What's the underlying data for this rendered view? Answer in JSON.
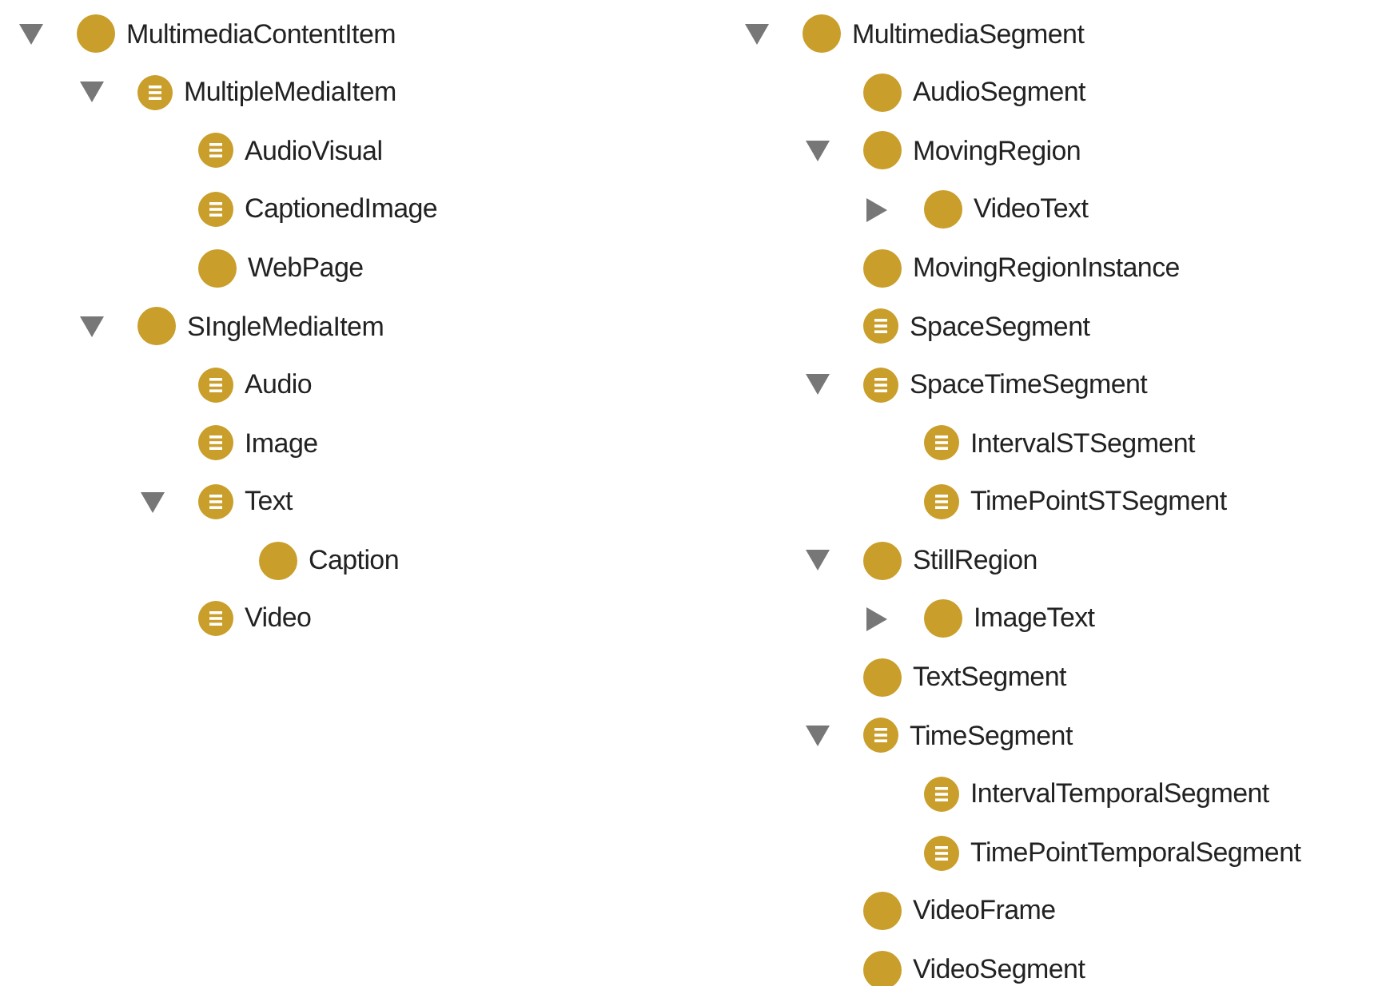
{
  "trees": [
    {
      "label": "MultimediaContentItem",
      "kind": "primitive",
      "expanded": true,
      "children": [
        {
          "label": "MultipleMediaItem",
          "kind": "defined",
          "expanded": true,
          "children": [
            {
              "label": "AudioVisual",
              "kind": "defined"
            },
            {
              "label": "CaptionedImage",
              "kind": "defined"
            },
            {
              "label": "WebPage",
              "kind": "primitive"
            }
          ]
        },
        {
          "label": "SIngleMediaItem",
          "kind": "primitive",
          "expanded": true,
          "children": [
            {
              "label": "Audio",
              "kind": "defined"
            },
            {
              "label": "Image",
              "kind": "defined"
            },
            {
              "label": "Text",
              "kind": "defined",
              "expanded": true,
              "children": [
                {
                  "label": "Caption",
                  "kind": "primitive"
                }
              ]
            },
            {
              "label": "Video",
              "kind": "defined"
            }
          ]
        }
      ]
    },
    {
      "label": "MultimediaSegment",
      "kind": "primitive",
      "expanded": true,
      "children": [
        {
          "label": "AudioSegment",
          "kind": "primitive"
        },
        {
          "label": "MovingRegion",
          "kind": "primitive",
          "expanded": true,
          "children": [
            {
              "label": "VideoText",
              "kind": "primitive",
              "expanded": false
            }
          ]
        },
        {
          "label": "MovingRegionInstance",
          "kind": "primitive"
        },
        {
          "label": "SpaceSegment",
          "kind": "defined"
        },
        {
          "label": "SpaceTimeSegment",
          "kind": "defined",
          "expanded": true,
          "children": [
            {
              "label": "IntervalSTSegment",
              "kind": "defined"
            },
            {
              "label": "TimePointSTSegment",
              "kind": "defined"
            }
          ]
        },
        {
          "label": "StillRegion",
          "kind": "primitive",
          "expanded": true,
          "children": [
            {
              "label": "ImageText",
              "kind": "primitive",
              "expanded": false
            }
          ]
        },
        {
          "label": "TextSegment",
          "kind": "primitive"
        },
        {
          "label": "TimeSegment",
          "kind": "defined",
          "expanded": true,
          "children": [
            {
              "label": "IntervalTemporalSegment",
              "kind": "defined"
            },
            {
              "label": "TimePointTemporalSegment",
              "kind": "defined"
            }
          ]
        },
        {
          "label": "VideoFrame",
          "kind": "primitive"
        },
        {
          "label": "VideoSegment",
          "kind": "primitive"
        }
      ]
    }
  ]
}
